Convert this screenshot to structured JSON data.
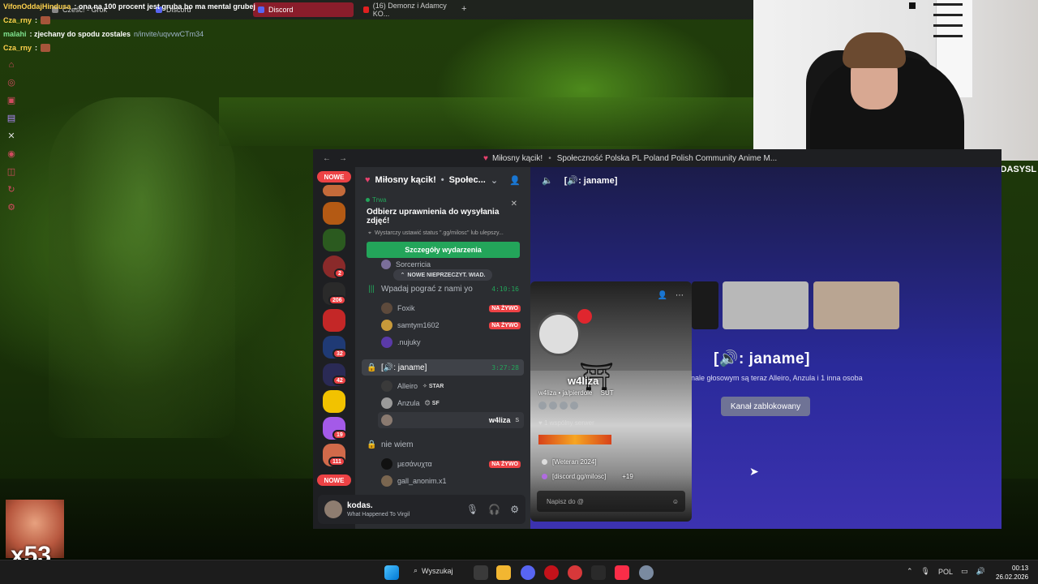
{
  "browser_tabs": [
    {
      "label": "Cześć! - Grok"
    },
    {
      "label": "Discord"
    },
    {
      "label": "Discord",
      "active": true
    },
    {
      "label": "(16) Demonz i Adamcy KO..."
    }
  ],
  "chat": [
    {
      "nick": "VifonOddajHindusa",
      "msg": ": ona na 100 procent jest gruba bo ma mental grubej"
    },
    {
      "nick": "Cza_rny",
      "msg": ":"
    },
    {
      "nick": "malahi",
      "msg": ": zjechany do spodu zostales",
      "link": "n/invite/uqvvwCTm34"
    },
    {
      "nick": "Cza_rny",
      "msg": ":"
    }
  ],
  "streamer": {
    "name": "KODASYSL",
    "emote_count": "x53"
  },
  "discord": {
    "titlebar": {
      "server": "Miłosny kącik!",
      "breadcrumb": "Społeczność Polska PL Poland Polish Community Anime M..."
    },
    "server_list_new_label": "NOWE",
    "badges": [
      "2",
      "206",
      "32",
      "42",
      "19",
      "111"
    ],
    "server_header": {
      "name": "Miłosny kącik!",
      "section": "Społec..."
    },
    "event": {
      "status": "Trwa",
      "title": "Odbierz uprawnienia do wysyłania zdjęć!",
      "subtitle": "Wystarczy ustawić status \".gg/milosc\" lub ulepszy...",
      "button": "Szczegóły wydarzenia"
    },
    "partial_member": "Sorcerricia",
    "unread_label": "NOWE NIEPRZECZYT. WIAD.",
    "live_label": "NA ŻYWO",
    "channels": [
      {
        "name": "Wpadaj pograć z nami yo",
        "time": "4:10:16",
        "members": [
          {
            "name": "Foxik",
            "live": true
          },
          {
            "name": "samtym1602",
            "live": true
          },
          {
            "name": ".nujuky",
            "live": false
          }
        ]
      },
      {
        "name": "[🔊: janame]",
        "time": "3:27:28",
        "selected": true,
        "members": [
          {
            "name": "Alleiro",
            "tag": "✧ STAR"
          },
          {
            "name": "Anzula",
            "tag": "😊 SF"
          },
          {
            "name": "w4liza",
            "tag": "S",
            "selected": true
          }
        ]
      },
      {
        "name": "nie wiem",
        "time": "",
        "members": [
          {
            "name": "μεσάνυχτα",
            "live": true
          },
          {
            "name": "gall_anonim.x1",
            "live": false
          }
        ]
      }
    ],
    "user": {
      "name": "kodas.",
      "status": "What Happened To Virgil"
    },
    "voice": {
      "header": "[🔊: janame]",
      "channel_name": "[🔊: janame]",
      "subtitle": "nale głosowym są teraz Alleiro, Anzula i 1 inna osoba",
      "locked_button": "Kanał zablokowany"
    },
    "profile": {
      "display_name": "w4liza",
      "username": "w4liza • ja/pierdole",
      "tag": "SUT",
      "common_servers": "1 wspólny serwer",
      "roles": [
        "[Weteran 2024]",
        "[discord.gg/milosc]"
      ],
      "extra_roles": "+19",
      "message_placeholder": "Napisz do @"
    }
  },
  "taskbar": {
    "search": "Wyszukaj",
    "lang": "POL",
    "time": "00:13",
    "date": "26.02.2026"
  },
  "colors": {
    "discord_red": "#ed4245",
    "discord_green": "#23a55a",
    "voice_bg": "#2a2a9a",
    "twitch": "#9146ff"
  }
}
